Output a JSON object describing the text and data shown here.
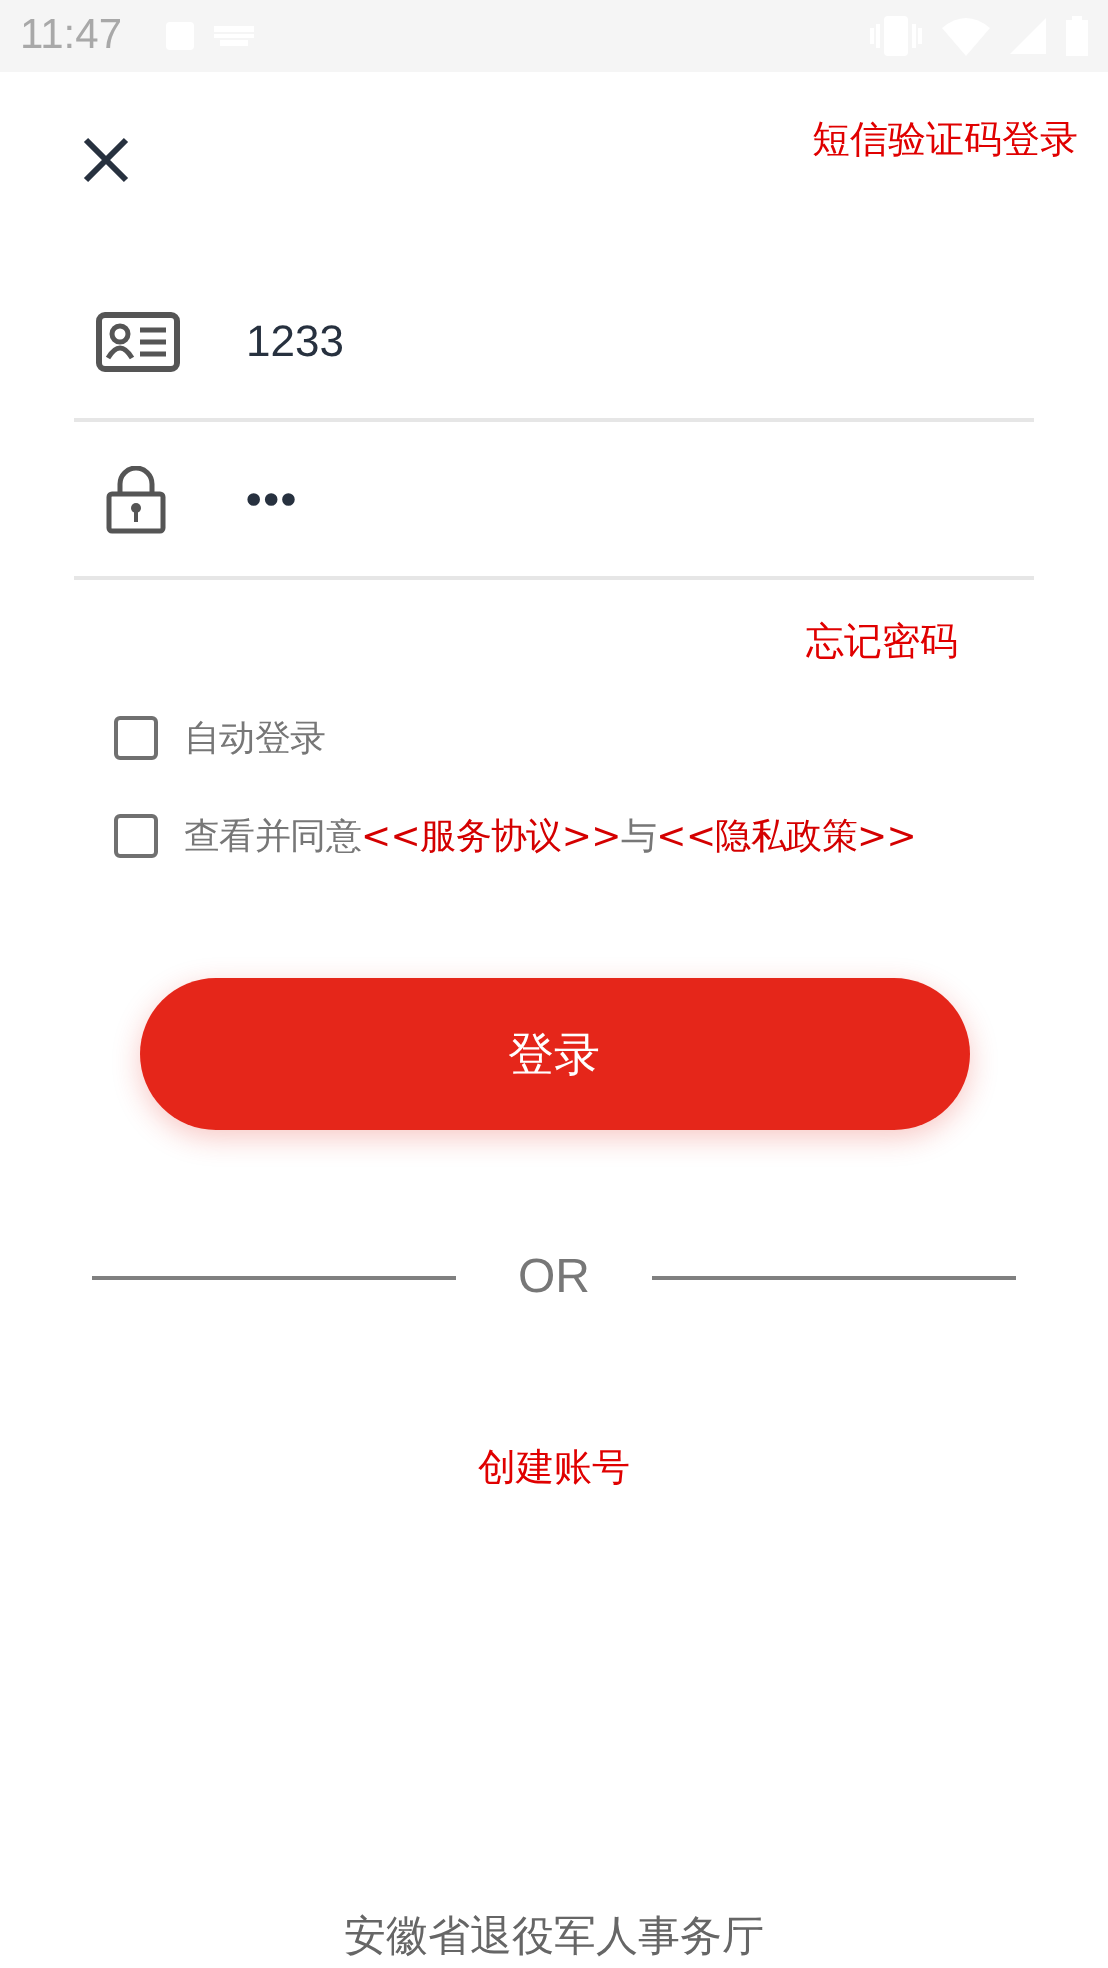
{
  "status_bar": {
    "time": "11:47"
  },
  "header": {
    "sms_login": "短信验证码登录"
  },
  "fields": [
    {
      "kind": "id",
      "value": "1233"
    },
    {
      "kind": "lock",
      "value": "•••"
    }
  ],
  "forgot_password": "忘记密码",
  "options": [
    {
      "kind": "plain",
      "label": "自动登录",
      "checked": false
    },
    {
      "kind": "agreement",
      "parts": [
        {
          "text": "查看并同意",
          "link": false
        },
        {
          "text": "<<服务协议>>",
          "link": true
        },
        {
          "text": "与",
          "link": false
        },
        {
          "text": "<<隐私政策>>",
          "link": true
        }
      ],
      "checked": false
    }
  ],
  "login_button": "登录",
  "divider_label": "OR",
  "create_account": "创建账号",
  "footer": "安徽省退役军人事务厅"
}
